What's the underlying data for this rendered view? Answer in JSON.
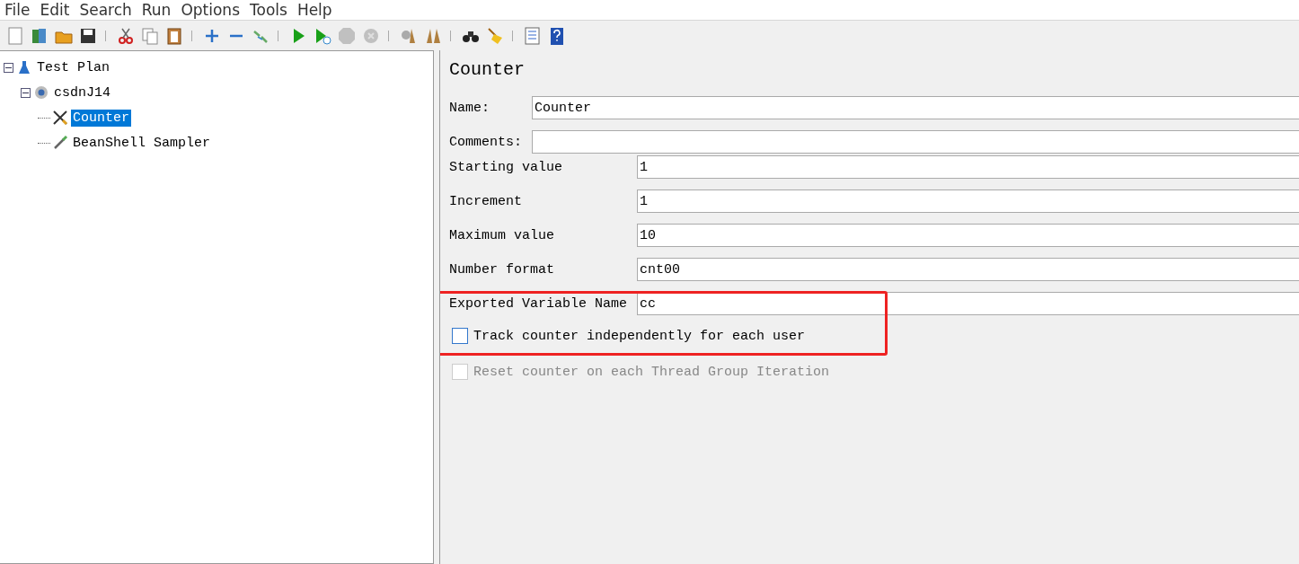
{
  "menu": [
    "File",
    "Edit",
    "Search",
    "Run",
    "Options",
    "Tools",
    "Help"
  ],
  "toolbar": [
    {
      "kind": "new",
      "disabled": false
    },
    {
      "kind": "templates",
      "disabled": false
    },
    {
      "kind": "open",
      "disabled": false
    },
    {
      "kind": "save",
      "disabled": false
    },
    {
      "kind": "sep"
    },
    {
      "kind": "cut",
      "disabled": false
    },
    {
      "kind": "copy",
      "disabled": false
    },
    {
      "kind": "paste",
      "disabled": false
    },
    {
      "kind": "sep"
    },
    {
      "kind": "expand",
      "disabled": false
    },
    {
      "kind": "collapse",
      "disabled": false
    },
    {
      "kind": "toggle",
      "disabled": false
    },
    {
      "kind": "sep"
    },
    {
      "kind": "start",
      "disabled": false
    },
    {
      "kind": "startnopause",
      "disabled": false
    },
    {
      "kind": "stop",
      "disabled": true
    },
    {
      "kind": "shutdown",
      "disabled": true
    },
    {
      "kind": "sep"
    },
    {
      "kind": "clear",
      "disabled": false
    },
    {
      "kind": "clearall",
      "disabled": false
    },
    {
      "kind": "sep"
    },
    {
      "kind": "search",
      "disabled": false
    },
    {
      "kind": "reset",
      "disabled": false
    },
    {
      "kind": "sep"
    },
    {
      "kind": "functions",
      "disabled": false
    },
    {
      "kind": "help",
      "disabled": false
    }
  ],
  "tree": [
    {
      "label": "Test Plan",
      "kind": "plan",
      "expanded": true,
      "selected": false,
      "children": [
        {
          "label": "csdnJ14",
          "kind": "group",
          "expanded": true,
          "selected": false,
          "children": [
            {
              "label": "Counter",
              "kind": "config",
              "selected": true
            },
            {
              "label": "BeanShell Sampler",
              "kind": "sampler",
              "selected": false
            }
          ]
        }
      ]
    }
  ],
  "panel": {
    "title": "Counter",
    "name": {
      "label": "Name:",
      "value": "Counter"
    },
    "comments": {
      "label": "Comments:"
    },
    "fields": [
      {
        "label": "Starting value",
        "value": "1"
      },
      {
        "label": "Increment",
        "value": "1"
      },
      {
        "label": "Maximum value",
        "value": "10"
      },
      {
        "label": "Number format",
        "value": "cnt00"
      },
      {
        "label": "Exported Variable Name",
        "value": "cc"
      }
    ],
    "checkboxes": [
      {
        "label": "Track counter independently for each user",
        "checked": false,
        "disabled": false
      },
      {
        "label": "Reset counter on each Thread Group Iteration",
        "checked": false,
        "disabled": true
      }
    ]
  }
}
